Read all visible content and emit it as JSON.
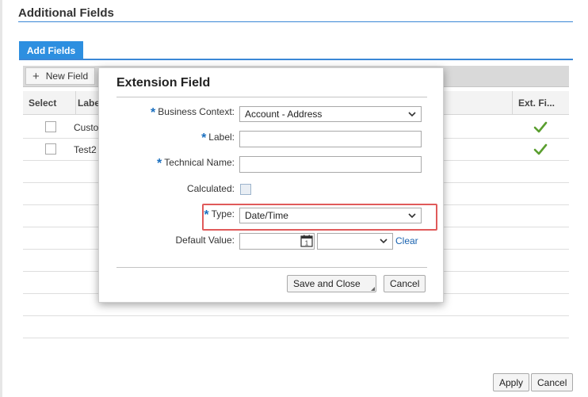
{
  "page": {
    "title": "Additional Fields"
  },
  "tabs": [
    {
      "label": "Add Fields",
      "active": true
    }
  ],
  "toolbar": {
    "new_field_label": "New Field"
  },
  "table": {
    "columns": [
      "Select",
      "Label",
      "Ext. Fi..."
    ],
    "rows": [
      {
        "label": "Custo",
        "selected": false,
        "extension_field": true
      },
      {
        "label": "Test2",
        "selected": false,
        "extension_field": true
      }
    ]
  },
  "dialog": {
    "title": "Extension Field",
    "fields": {
      "business_context": {
        "label": "Business Context:",
        "required": true,
        "value": "Account - Address"
      },
      "label": {
        "label": "Label:",
        "required": true,
        "value": ""
      },
      "technical_name": {
        "label": "Technical Name:",
        "required": true,
        "value": ""
      },
      "calculated": {
        "label": "Calculated:",
        "checked": false
      },
      "type": {
        "label": "Type:",
        "required": true,
        "value": "Date/Time"
      },
      "default_value": {
        "label": "Default Value:",
        "date": "",
        "time": "",
        "calendar_day": "1",
        "clear_label": "Clear"
      }
    },
    "buttons": {
      "save_close": "Save and Close",
      "cancel": "Cancel"
    }
  },
  "footer": {
    "apply": "Apply",
    "cancel": "Cancel"
  },
  "colors": {
    "accent": "#2d8fe0",
    "required_asterisk": "#1a6fbf",
    "highlight_border": "#e05a5a",
    "check_green": "#5a9e2f"
  },
  "icons": [
    "plus-icon",
    "checkmark-icon",
    "chevron-down-icon",
    "calendar-icon"
  ]
}
